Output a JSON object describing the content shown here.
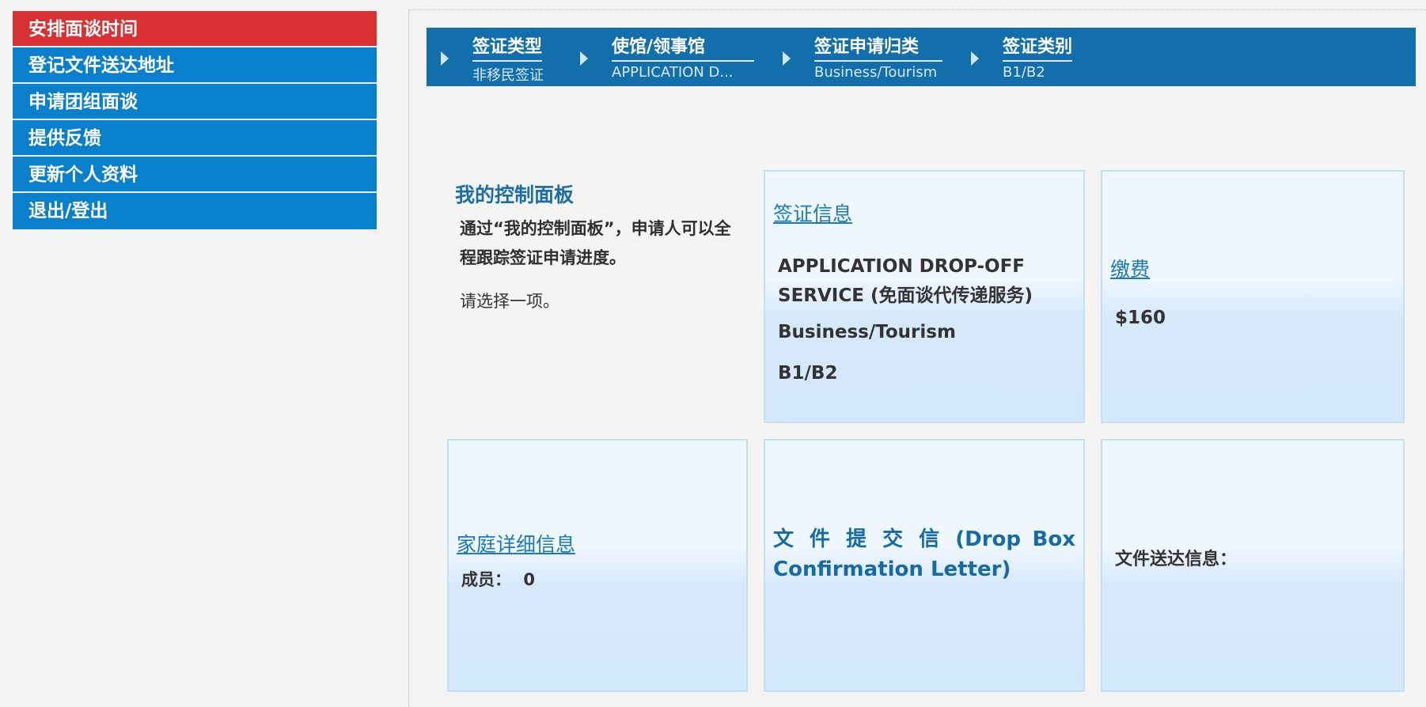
{
  "sidebar": {
    "items": [
      {
        "label": "安排面谈时间"
      },
      {
        "label": "登记文件送达地址"
      },
      {
        "label": "申请团组面谈"
      },
      {
        "label": "提供反馈"
      },
      {
        "label": "更新个人资料"
      },
      {
        "label": "退出/登出"
      }
    ]
  },
  "breadcrumb": [
    {
      "title": "签证类型",
      "sub": "非移民签证"
    },
    {
      "title": "使馆/领事馆",
      "sub": "APPLICATION D..."
    },
    {
      "title": "签证申请归类",
      "sub": "Business/Tourism"
    },
    {
      "title": "签证类别",
      "sub": "B1/B2"
    }
  ],
  "dashboard": {
    "title": "我的控制面板",
    "description": "通过“我的控制面板”，申请人可以全程跟踪签证申请进度。",
    "prompt": "请选择一项。"
  },
  "visa_info": {
    "link": "签证信息",
    "line1": "APPLICATION DROP-OFF SERVICE (免面谈代传递服务)",
    "line2": "Business/Tourism",
    "line3": "B1/B2"
  },
  "fee": {
    "link": "缴费",
    "amount": "$160"
  },
  "family": {
    "link": "家庭详细信息",
    "members_label": "成员：",
    "members_count": "0"
  },
  "drop_box": {
    "title": "文 件 提 交 信 (Drop Box Confirmation Letter)"
  },
  "delivery": {
    "label": "文件送达信息："
  },
  "colors": {
    "sidebar_blue": "#0a7fcc",
    "sidebar_active_red": "#d83133",
    "crumb_bar": "#126fab",
    "link_blue": "#1c7ab9"
  }
}
